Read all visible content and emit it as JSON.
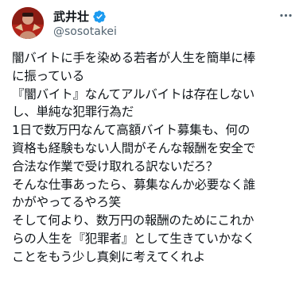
{
  "tweet": {
    "author": {
      "display_name": "武井壮",
      "handle": "@sosotakei",
      "verified": true,
      "verified_color": "#1d9bf0"
    },
    "more_icon": "ellipsis-icon",
    "lines": [
      "闇バイトに手を染める若者が人生を簡単に棒",
      "に振っている",
      "『闇バイト』なんてアルバイトは存在しない",
      "し、単純な犯罪行為だ",
      "1日で数万円なんて高額バイト募集も、何の",
      "資格も経験もない人間がそんな報酬を安全で",
      "合法な作業で受け取れる訳ないだろ？",
      "そんな仕事あったら、募集なんか必要なく誰",
      "かがやってるやろ笑",
      "そして何より、数万円の報酬のためにこれか",
      "らの人生を『犯罪者』として生きていかなく",
      "ことをもう少し真剣に考えてくれよ"
    ]
  }
}
